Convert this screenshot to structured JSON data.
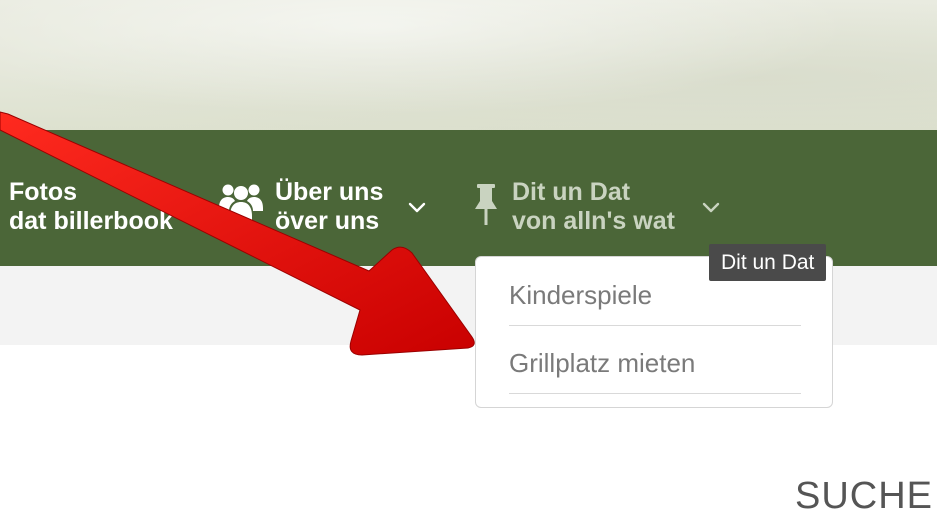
{
  "nav": {
    "fotos": {
      "line1": "Fotos",
      "line2": "dat billerbook"
    },
    "ueber": {
      "line1": "Über uns",
      "line2": "över uns",
      "icon": "users-icon"
    },
    "dit": {
      "line1": "Dit un Dat",
      "line2": "von alln's wat",
      "icon": "pushpin-icon"
    }
  },
  "dropdown": {
    "items": [
      {
        "label": "Kinderspiele"
      },
      {
        "label": "Grillplatz mieten"
      }
    ]
  },
  "tooltip": {
    "text": "Dit un Dat"
  },
  "section": {
    "heading": "SUCHE"
  },
  "annotation": {
    "arrow_color": "#e00000"
  },
  "colors": {
    "navbar": "#4b6638",
    "nav_text": "#ffffff",
    "nav_text_active": "#c9d3c0",
    "subbar": "#f3f3f3",
    "dropdown_text": "#7a7a7a",
    "tooltip_bg": "#4a4a4a"
  }
}
